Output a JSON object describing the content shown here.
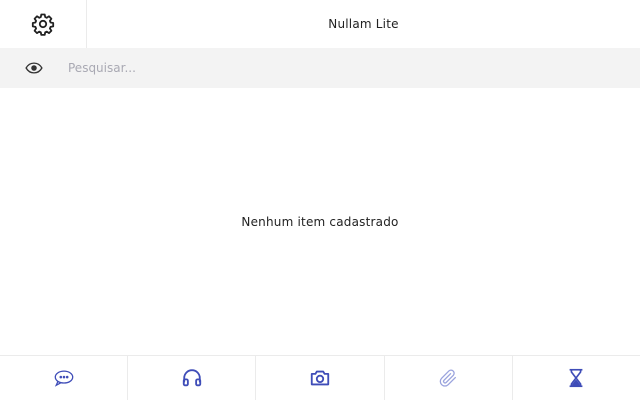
{
  "header": {
    "title": "Nullam Lite",
    "settings_icon": "gear-icon"
  },
  "search": {
    "icon": "eye-icon",
    "placeholder": "Pesquisar...",
    "value": ""
  },
  "content": {
    "empty_message": "Nenhum item cadastrado"
  },
  "toolbar": {
    "accent_color": "#3f4db8",
    "items": [
      {
        "icon": "chat-bubble-icon"
      },
      {
        "icon": "headphones-icon"
      },
      {
        "icon": "camera-icon"
      },
      {
        "icon": "paperclip-icon"
      },
      {
        "icon": "hourglass-icon"
      }
    ]
  }
}
